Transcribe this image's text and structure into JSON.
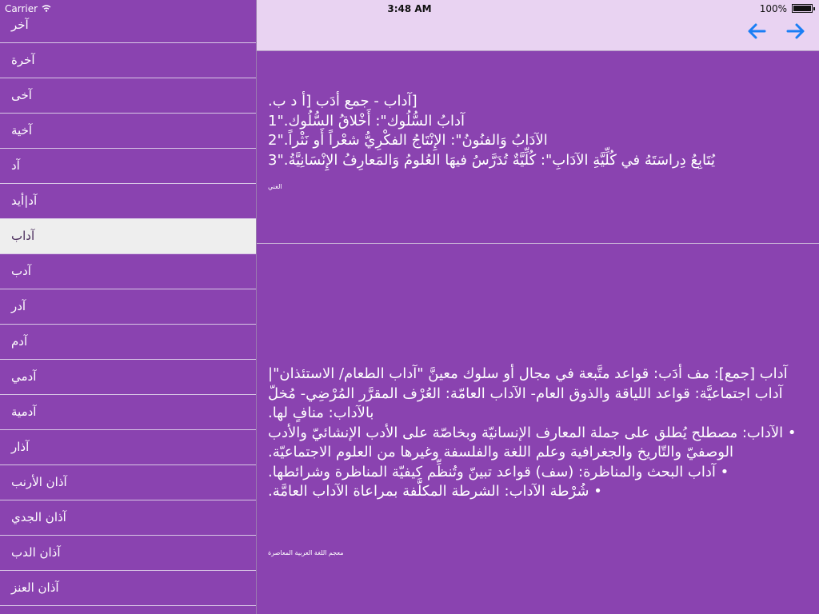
{
  "status_bar": {
    "carrier": "Carrier",
    "time": "3:48 AM",
    "battery": "100%",
    "battery_level": 1.0
  },
  "navbar": {
    "back_icon": "arrow-left-icon",
    "forward_icon": "arrow-right-icon",
    "accent_color": "#1a7ef5"
  },
  "sidebar": {
    "selected_index": 6,
    "items": [
      {
        "label": "آخر"
      },
      {
        "label": "آخرة"
      },
      {
        "label": "آخى"
      },
      {
        "label": "آخية"
      },
      {
        "label": "آد"
      },
      {
        "label": "آد|أيد"
      },
      {
        "label": "آداب"
      },
      {
        "label": "آدب"
      },
      {
        "label": "آدر"
      },
      {
        "label": "آدم"
      },
      {
        "label": "آدمي"
      },
      {
        "label": "آدمية"
      },
      {
        "label": "آذار"
      },
      {
        "label": "آذان الأرنب"
      },
      {
        "label": "آذان الجدي"
      },
      {
        "label": "آذان الدب"
      },
      {
        "label": "آذان العنز"
      }
    ]
  },
  "definitions": [
    {
      "text": "[آداب - جمع أدَب [أ د ب.\nآدابُ السُّلُوك\": أَخْلاقُ السُّلُوك.\"1\nالآدَابُ وَالفنُونُ\": الإِنْتَاجُ الفكْرِيُّ شعْراً أَو نَثْراً.\"2\nيُتَابِعُ دِراسَتَهُ في كُلِّيَّةِ الآدَابِ\": كُلِّيَّةٌ تُدَرَّسُ فيهَا العُلومُ وَالمَعارِفُ الإِنْسَانِيَّةُ.\"3",
      "source": "الغني"
    },
    {
      "text": "آداب [جمع]: مف أدَب: قواعد متَّبعة في مجال أو سلوك معينَّ \"آداب الطعام/ الاستئذان\"| آداب اجتماعيَّة: قواعد اللياقة والذوق العام- الآداب العامّة: العُرْف المقرَّر المُرْضِي- مُخلّ بالآداب: منافٍ لها.\n• الآداب: مصطلح يُطلق على جملة المعارف الإنسانيّة وبخاصّة على الأدب الإنشائيّ والأدب الوصفيّ والتّاريخ والجغرافية وعلم اللغة والفلسفة وغيرها من العلوم الاجتماعيّة.\n• آداب البحث والمناظرة: (سف) قواعد تبينّ وتُنظِّم كيفيّة المناظرة وشرائطها.\n• شُرْطة الآداب: الشرطة المكلَّفة بمراعاة الآداب العامَّة.",
      "source": "معجم اللغة العربية المعاصرة"
    }
  ],
  "colors": {
    "panel_purple": "#8a43b0",
    "navbar_lavender": "#e9d3f2",
    "selected_row": "#eeeeee"
  }
}
